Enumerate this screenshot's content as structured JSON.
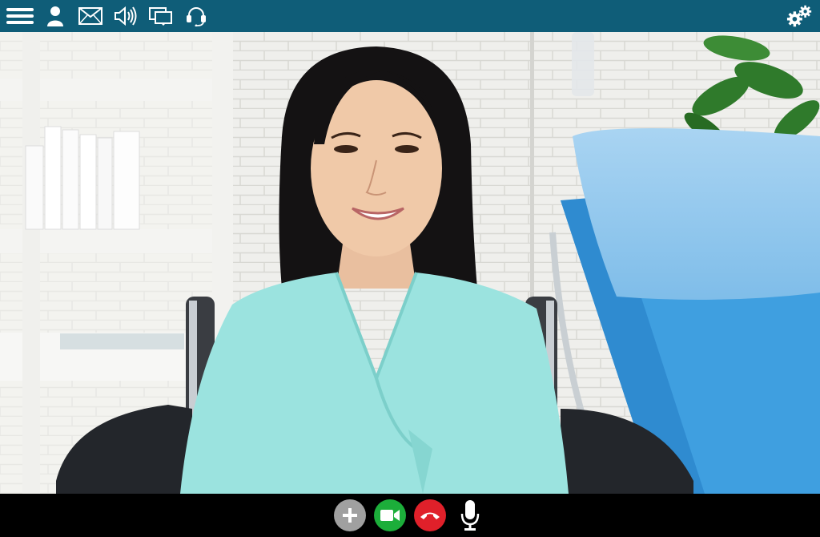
{
  "toolbar": {
    "icons": [
      "menu-icon",
      "user-icon",
      "mail-icon",
      "speaker-icon",
      "screens-icon",
      "headset-icon"
    ],
    "settings_icon": "gear-icon",
    "background": "#0f5d78"
  },
  "video": {
    "subject": "video-feed"
  },
  "controls": {
    "buttons": [
      {
        "name": "add-participant-button",
        "icon": "plus-icon",
        "color": "#a0a0a0"
      },
      {
        "name": "camera-button",
        "icon": "video-camera-icon",
        "color": "#1cae3a"
      },
      {
        "name": "hang-up-button",
        "icon": "phone-hangup-icon",
        "color": "#e0202a"
      },
      {
        "name": "microphone-button",
        "icon": "microphone-icon",
        "color": "#ffffff"
      }
    ]
  }
}
